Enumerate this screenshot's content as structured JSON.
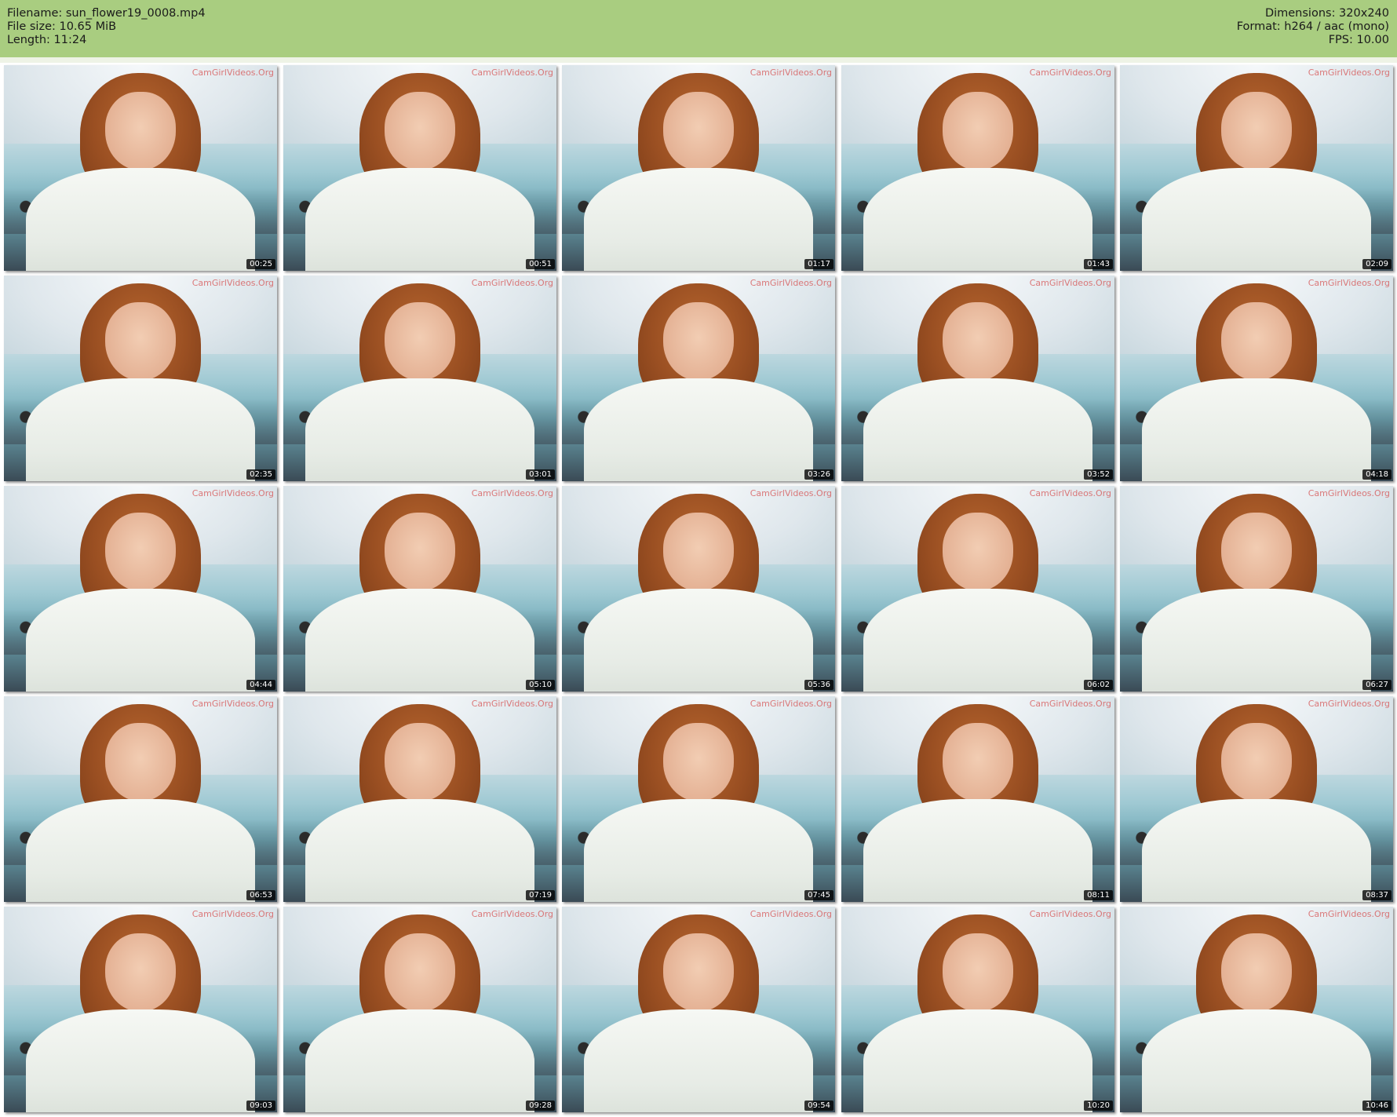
{
  "meta": {
    "filename": "Filename: sun_flower19_0008.mp4",
    "filesize": "File size: 10.65 MiB",
    "length": "Length: 11:24",
    "dimensions": "Dimensions: 320x240",
    "format": "Format: h264 / aac (mono)",
    "fps": "FPS: 10.00"
  },
  "watermark": "CamGirlVideos.Org",
  "thumbnails": [
    {
      "time": "00:25"
    },
    {
      "time": "00:51"
    },
    {
      "time": "01:17"
    },
    {
      "time": "01:43"
    },
    {
      "time": "02:09"
    },
    {
      "time": "02:35"
    },
    {
      "time": "03:01"
    },
    {
      "time": "03:26"
    },
    {
      "time": "03:52"
    },
    {
      "time": "04:18"
    },
    {
      "time": "04:44"
    },
    {
      "time": "05:10"
    },
    {
      "time": "05:36"
    },
    {
      "time": "06:02"
    },
    {
      "time": "06:27"
    },
    {
      "time": "06:53"
    },
    {
      "time": "07:19"
    },
    {
      "time": "07:45"
    },
    {
      "time": "08:11"
    },
    {
      "time": "08:37"
    },
    {
      "time": "09:03"
    },
    {
      "time": "09:28"
    },
    {
      "time": "09:54"
    },
    {
      "time": "10:20"
    },
    {
      "time": "10:46"
    }
  ]
}
